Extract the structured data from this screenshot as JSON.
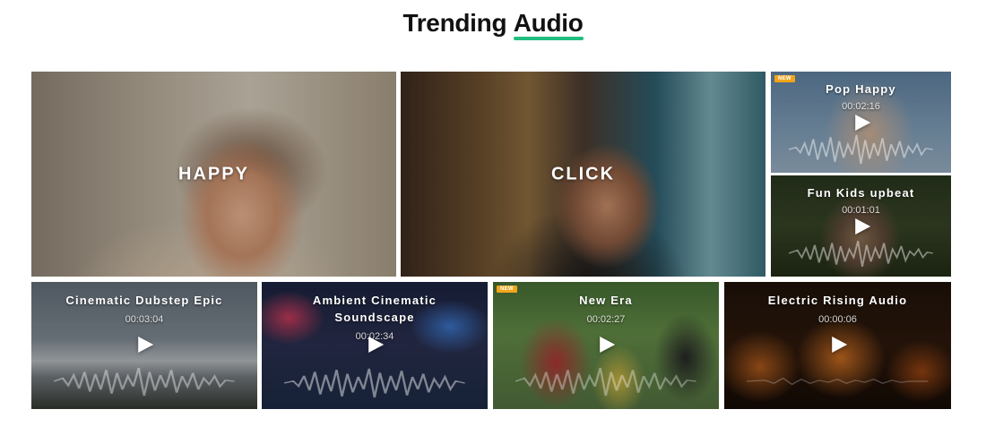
{
  "header": {
    "title_part1": "Trending",
    "title_part2": "Audio"
  },
  "colors": {
    "accent": "#1fbf7f",
    "badge": "#f2a51a"
  },
  "featured": [
    {
      "label": "HAPPY",
      "image": "woman-laughing-sunglasses"
    },
    {
      "label": "CLICK",
      "image": "man-with-camera"
    }
  ],
  "tracks": [
    {
      "title": "Pop Happy",
      "duration": "00:02:16",
      "badge": "NEW",
      "image": "woman-dancing"
    },
    {
      "title": "Fun Kids upbeat",
      "duration": "00:01:01",
      "badge": "",
      "image": "child-in-hood"
    },
    {
      "title": "Cinematic Dubstep Epic",
      "duration": "00:03:04",
      "badge": "",
      "image": "snowy-mountains"
    },
    {
      "title": "Ambient Cinematic Soundscape",
      "duration": "00:02:34",
      "badge": "",
      "image": "city-night-crowd"
    },
    {
      "title": "New Era",
      "duration": "00:02:27",
      "badge": "NEW",
      "image": "street-parade"
    },
    {
      "title": "Electric Rising Audio",
      "duration": "00:00:06",
      "badge": "",
      "image": "jack-o-lanterns"
    }
  ]
}
